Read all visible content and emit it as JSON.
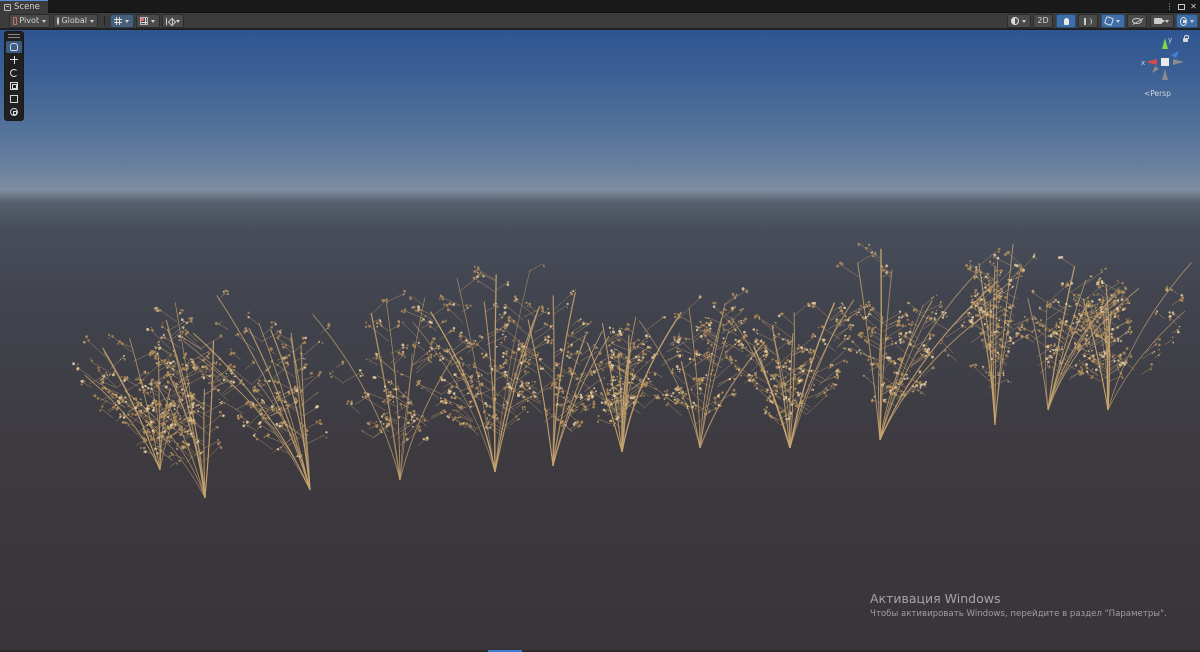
{
  "window": {
    "tab_label": "Scene",
    "tab_icon": "scene-tab-icon",
    "controls": [
      "window-menu-icon",
      "maximize-icon",
      "close-icon"
    ]
  },
  "toolbar": {
    "pivot_label": "Pivot",
    "global_label": "Global",
    "mode_2d_label": "2D"
  },
  "viewport": {
    "projection_label": "Persp",
    "axes": {
      "x": "x",
      "y": "y"
    },
    "colors": {
      "sky_top": "#2f5591",
      "horizon": "#7f8ea0",
      "ground": "#39343a",
      "plant": "#c9a670",
      "x_axis": "#d84a4a",
      "y_axis": "#7ed84a",
      "z_axis": "#4a7fd8"
    },
    "scene_objects": [
      "dry-weed-1",
      "dry-weed-2",
      "dry-weed-3",
      "dry-weed-4",
      "dry-weed-5",
      "dry-weed-6",
      "dry-weed-7",
      "dry-weed-8",
      "dry-weed-9",
      "dry-weed-10",
      "dry-weed-11",
      "dry-weed-12",
      "dry-weed-13"
    ]
  },
  "tools": [
    "view-tool",
    "move-tool",
    "rotate-tool",
    "scale-tool",
    "rect-tool",
    "transform-tool"
  ],
  "watermark": {
    "title": "Активация Windows",
    "subtitle": "Чтобы активировать Windows, перейдите в раздел \"Параметры\"."
  }
}
